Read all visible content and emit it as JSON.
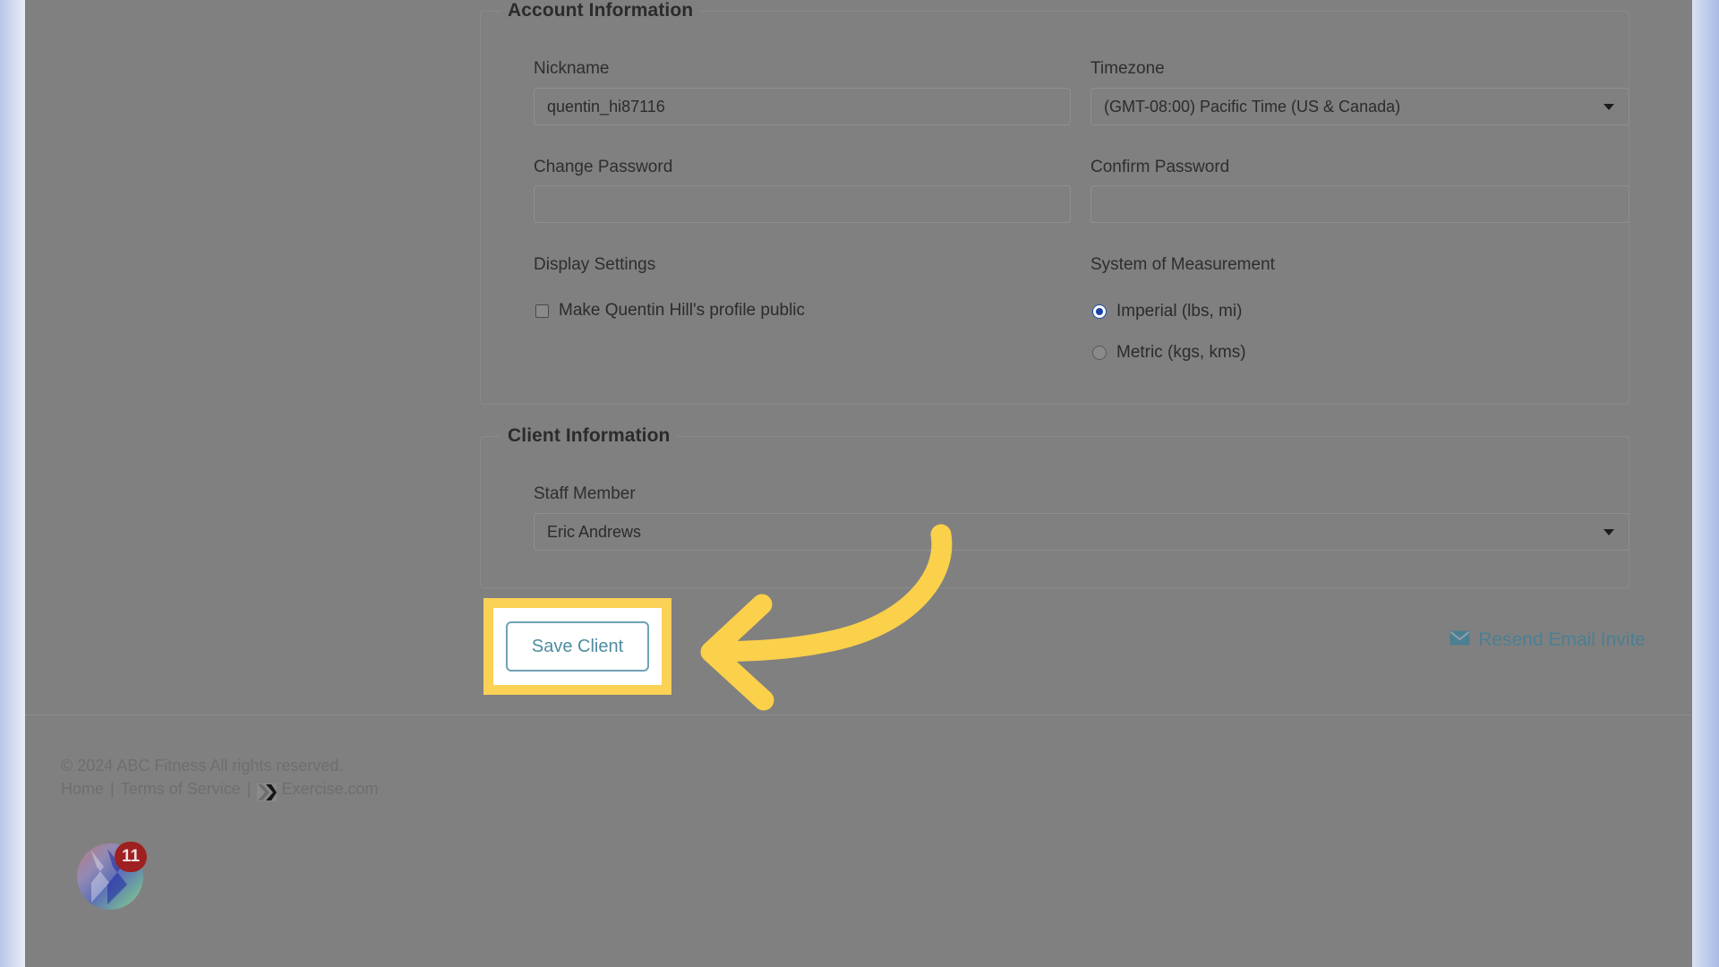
{
  "account_information": {
    "legend": "Account Information",
    "nickname": {
      "label": "Nickname",
      "value": "quentin_hi87116",
      "placeholder": ""
    },
    "timezone": {
      "label": "Timezone",
      "value": "(GMT-08:00) Pacific Time (US & Canada)"
    },
    "change_password": {
      "label": "Change Password",
      "value": "",
      "placeholder": ""
    },
    "confirm_password": {
      "label": "Confirm Password",
      "value": "",
      "placeholder": ""
    },
    "display_settings": {
      "label": "Display Settings",
      "public_profile_label": "Make Quentin Hill's profile public",
      "public_profile_checked": false
    },
    "system_of_measurement": {
      "label": "System of Measurement",
      "options": [
        {
          "label": "Imperial (lbs, mi)",
          "selected": true
        },
        {
          "label": "Metric (kgs, kms)",
          "selected": false
        }
      ]
    }
  },
  "client_information": {
    "legend": "Client Information",
    "staff_member": {
      "label": "Staff Member",
      "value": "Eric Andrews"
    }
  },
  "actions": {
    "save_label": "Save Client",
    "resend_label": "Resend Email Invite",
    "resend_icon": "envelope-icon"
  },
  "footer": {
    "copyright": "© 2024 ABC Fitness All rights reserved.",
    "home": "Home",
    "terms": "Terms of Service",
    "brand": "Exercise.com",
    "separator": "|"
  },
  "chat_widget": {
    "badge_count": "11",
    "icon": "chat-bubble-icon"
  },
  "colors": {
    "highlight_yellow": "#FBD156",
    "arrow_yellow": "#FBD04A",
    "button_teal": "#6FA2B4",
    "link_teal": "#4B7F92",
    "radio_blue": "#1B43A8",
    "badge_red": "#9E2020",
    "overlay_gray": "#808080"
  }
}
